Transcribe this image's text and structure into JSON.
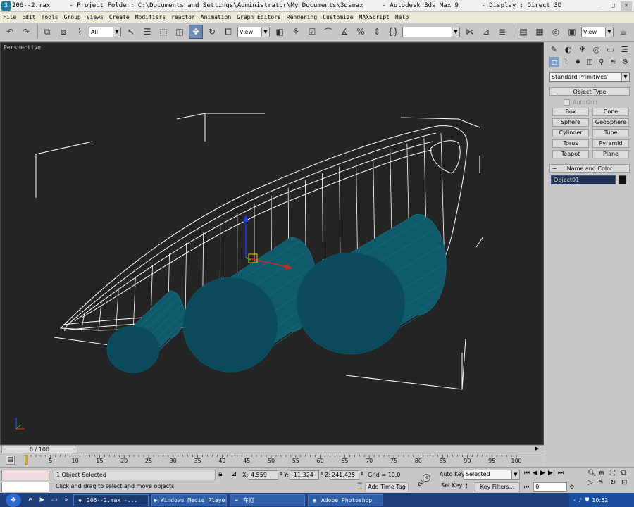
{
  "window": {
    "title": "206--2.max     - Project Folder: C:\\Documents and Settings\\Administrator\\My Documents\\3dsmax     - Autodesk 3ds Max 9      - Display : Direct 3D",
    "minimize": "_",
    "maximize": "□",
    "close": "×"
  },
  "menu": [
    "File",
    "Edit",
    "Tools",
    "Group",
    "Views",
    "Create",
    "Modifiers",
    "reactor",
    "Animation",
    "Graph Editors",
    "Rendering",
    "Customize",
    "MAXScript",
    "Help"
  ],
  "toolbar": {
    "selection_filter": "All",
    "ref_coord": "View",
    "named_selection": "",
    "render_view": "View"
  },
  "viewport": {
    "label": "Perspective"
  },
  "command_panel": {
    "category": "Standard Primitives",
    "object_type_title": "Object Type",
    "autogrid": "AutoGrid",
    "buttons": [
      "Box",
      "Cone",
      "Sphere",
      "GeoSphere",
      "Cylinder",
      "Tube",
      "Torus",
      "Pyramid",
      "Teapot",
      "Plane"
    ],
    "name_color_title": "Name and Color",
    "object_name": "Object01",
    "object_color": "#111111"
  },
  "timeline": {
    "slider_label": "0 / 100",
    "ticks": [
      "0",
      "5",
      "10",
      "15",
      "20",
      "25",
      "30",
      "35",
      "40",
      "45",
      "50",
      "55",
      "60",
      "65",
      "70",
      "75",
      "80",
      "85",
      "90",
      "95",
      "100"
    ]
  },
  "status": {
    "selection": "1 Object Selected",
    "prompt": "Click and drag to select and move objects",
    "x_label": "X:",
    "x": "4.559",
    "y_label": "Y:",
    "y": "-11.324",
    "z_label": "Z:",
    "z": "241.425",
    "grid": "Grid = 10.0",
    "add_time_tag": "Add Time Tag",
    "auto_key": "Auto Key",
    "set_key": "Set Key",
    "key_mode": "Selected",
    "key_filters": "Key Filters...",
    "current_frame": "0"
  },
  "taskbar": {
    "tasks": [
      {
        "label": "206--2.max       -...",
        "icon": "3ds-max-icon"
      },
      {
        "label": "Windows Media Player",
        "icon": "media-player-icon"
      },
      {
        "label": "车灯",
        "icon": "folder-icon"
      },
      {
        "label": "Adobe Photoshop",
        "icon": "photoshop-icon"
      }
    ],
    "clock": "10:52"
  },
  "colors": {
    "viewport_bg": "#242424",
    "cylinder_fill": "#0f5a6b",
    "cylinder_face": "#0a4a5a",
    "wire": "#ffffff",
    "active_button": "#6f8ab0"
  }
}
